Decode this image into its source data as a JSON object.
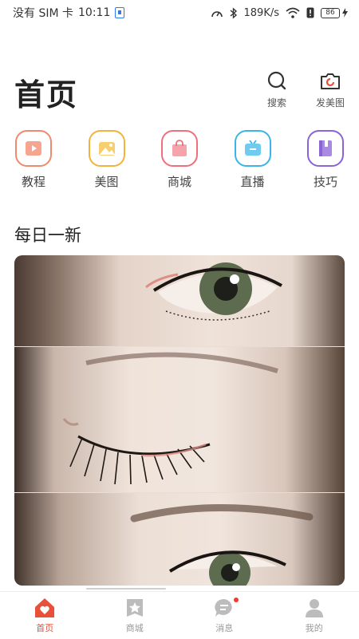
{
  "status_bar": {
    "carrier": "没有 SIM 卡",
    "time": "10:11",
    "net_speed": "189K/s",
    "battery": "86"
  },
  "header": {
    "title": "首页",
    "search_label": "搜索",
    "post_label": "发美图"
  },
  "categories": [
    {
      "label": "教程",
      "icon": "video-icon",
      "color": "#f08a6e"
    },
    {
      "label": "美图",
      "icon": "image-icon",
      "color": "#f3b23c"
    },
    {
      "label": "商城",
      "icon": "shopping-bag-icon",
      "color": "#ef6f7c"
    },
    {
      "label": "直播",
      "icon": "tv-icon",
      "color": "#3bb4e6"
    },
    {
      "label": "技巧",
      "icon": "book-icon",
      "color": "#8a63d6"
    }
  ],
  "section": {
    "title": "每日一新"
  },
  "bottom_nav": {
    "active": "home",
    "items": [
      {
        "label": "首页",
        "icon": "home-heart-icon"
      },
      {
        "label": "商城",
        "icon": "star-bag-icon"
      },
      {
        "label": "消息",
        "icon": "chat-bubble-icon"
      },
      {
        "label": "我的",
        "icon": "user-icon"
      }
    ],
    "accent": "#e8503a"
  }
}
